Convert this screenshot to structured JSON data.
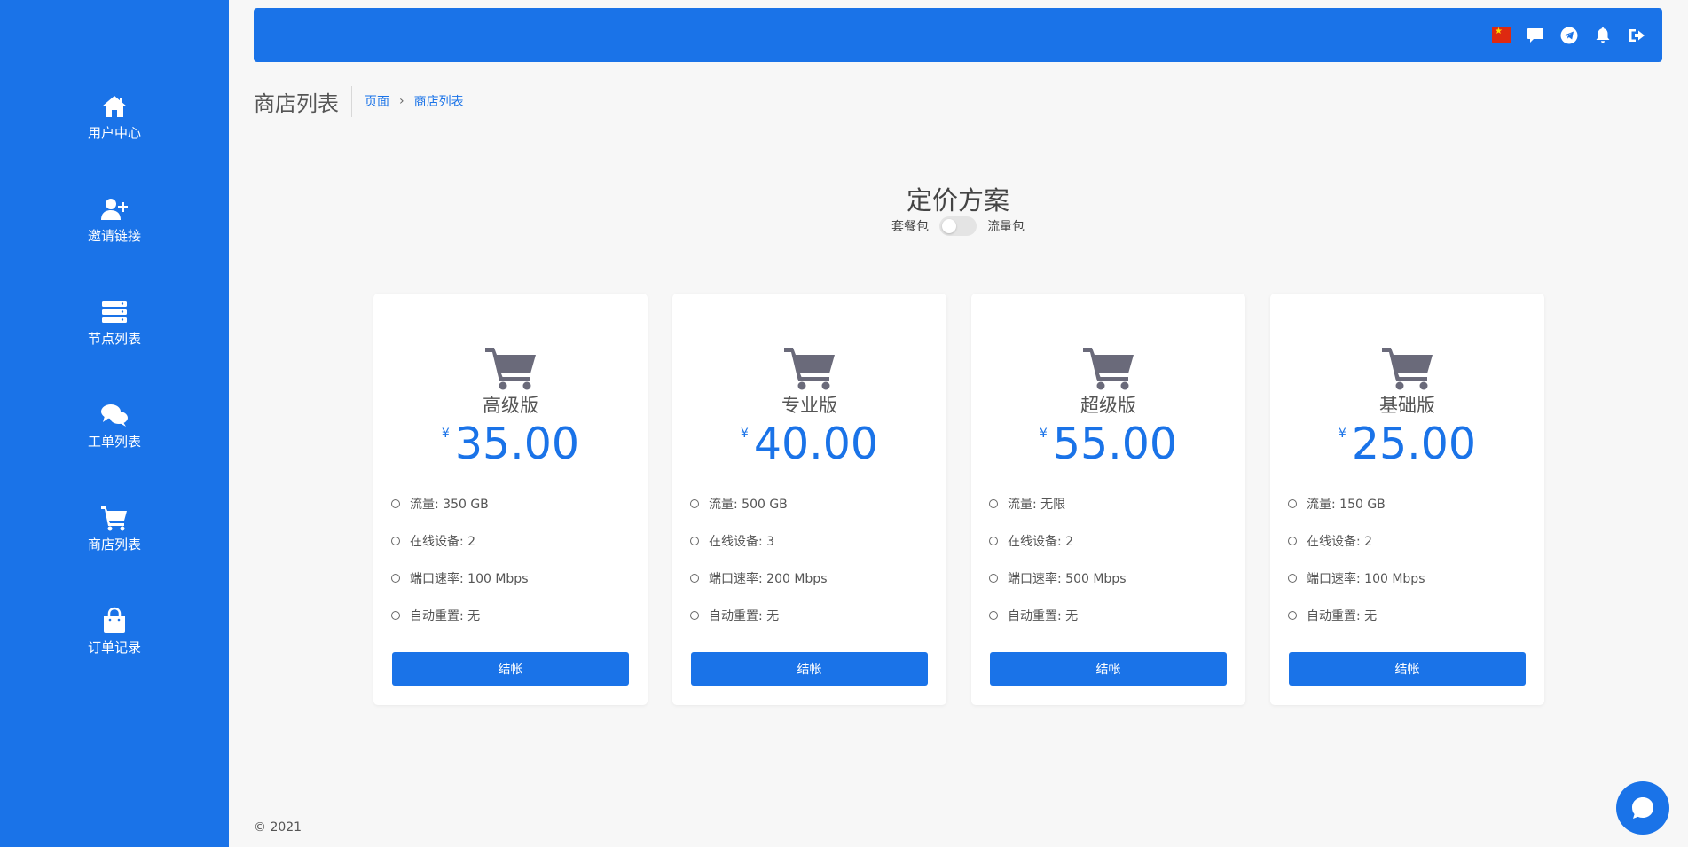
{
  "sidebar": {
    "items": [
      {
        "label": "用户中心",
        "icon": "home-icon"
      },
      {
        "label": "邀请链接",
        "icon": "user-plus-icon"
      },
      {
        "label": "节点列表",
        "icon": "server-icon"
      },
      {
        "label": "工单列表",
        "icon": "comments-icon"
      },
      {
        "label": "商店列表",
        "icon": "cart-icon"
      },
      {
        "label": "订单记录",
        "icon": "shopping-bag-icon"
      }
    ]
  },
  "header": {
    "icons": [
      "china-flag-icon",
      "message-icon",
      "telegram-icon",
      "bell-icon",
      "logout-icon"
    ]
  },
  "page": {
    "title": "商店列表",
    "breadcrumb": [
      "页面",
      "商店列表"
    ]
  },
  "pricing": {
    "title": "定价方案",
    "toggle_left": "套餐包",
    "toggle_right": "流量包",
    "toggle_on": false
  },
  "plans": [
    {
      "name": "高级版",
      "currency": "¥",
      "price": "35.00",
      "features": [
        "流量: 350 GB",
        "在线设备: 2",
        "端口速率: 100 Mbps",
        "自动重置: 无"
      ],
      "button": "结帐"
    },
    {
      "name": "专业版",
      "currency": "¥",
      "price": "40.00",
      "features": [
        "流量: 500 GB",
        "在线设备: 3",
        "端口速率: 200 Mbps",
        "自动重置: 无"
      ],
      "button": "结帐"
    },
    {
      "name": "超级版",
      "currency": "¥",
      "price": "55.00",
      "features": [
        "流量: 无限",
        "在线设备: 2",
        "端口速率: 500 Mbps",
        "自动重置: 无"
      ],
      "button": "结帐"
    },
    {
      "name": "基础版",
      "currency": "¥",
      "price": "25.00",
      "features": [
        "流量: 150 GB",
        "在线设备: 2",
        "端口速率: 100 Mbps",
        "自动重置: 无"
      ],
      "button": "结帐"
    }
  ],
  "footer": {
    "text": "© 2021"
  },
  "colors": {
    "accent": "#1a73e8",
    "background": "#f7f7f7",
    "card": "#ffffff"
  }
}
